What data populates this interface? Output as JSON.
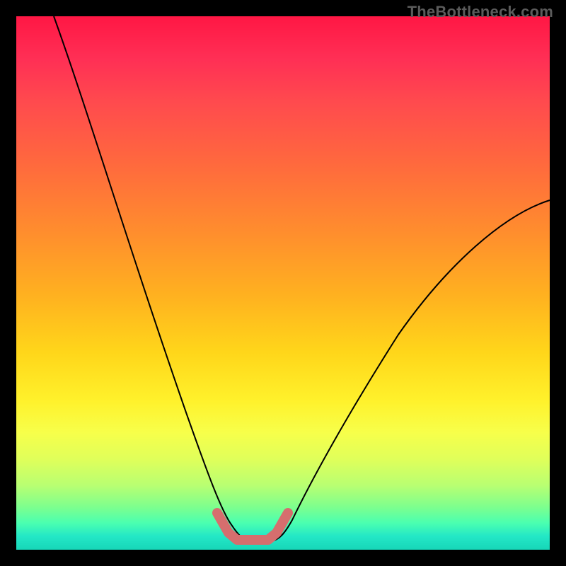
{
  "watermark": "TheBottleneck.com",
  "colors": {
    "curve": "#000000",
    "basin_highlight": "#d66e6e",
    "frame_border": "#000000"
  },
  "chart_data": {
    "type": "line",
    "title": "",
    "xlabel": "",
    "ylabel": "",
    "xlim": [
      0,
      100
    ],
    "ylim": [
      0,
      100
    ],
    "grid": false,
    "x": [
      0,
      5,
      10,
      15,
      20,
      25,
      30,
      35,
      38,
      40,
      42,
      44,
      46,
      48,
      50,
      55,
      60,
      65,
      70,
      75,
      80,
      85,
      90,
      95,
      100
    ],
    "values": [
      100,
      87,
      75,
      63,
      52,
      41,
      31,
      20,
      10,
      4,
      1,
      0,
      0,
      1,
      4,
      12,
      20,
      27,
      34,
      40,
      45,
      50,
      54,
      57,
      60
    ],
    "basin": {
      "x_range": [
        38,
        51
      ],
      "y_range": [
        0,
        6
      ],
      "points_xy": [
        [
          38,
          6
        ],
        [
          40,
          2
        ],
        [
          42,
          0.5
        ],
        [
          44,
          0
        ],
        [
          46,
          0
        ],
        [
          48,
          0.5
        ],
        [
          50,
          2
        ],
        [
          51,
          6
        ]
      ]
    },
    "annotations": []
  }
}
